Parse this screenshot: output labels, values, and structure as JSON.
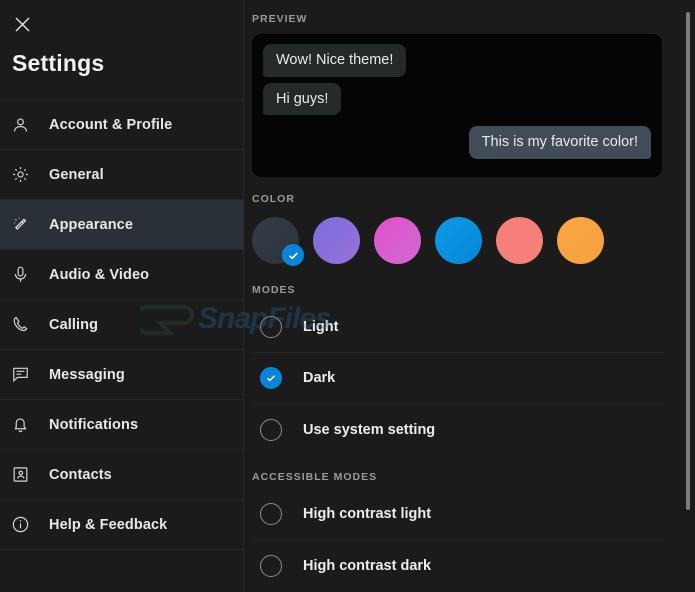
{
  "window": {
    "close_icon": "close-icon"
  },
  "sidebar": {
    "title": "Settings",
    "items": [
      {
        "label": "Account & Profile",
        "icon": "person-icon",
        "active": false
      },
      {
        "label": "General",
        "icon": "gear-icon",
        "active": false
      },
      {
        "label": "Appearance",
        "icon": "magic-wand-icon",
        "active": true
      },
      {
        "label": "Audio & Video",
        "icon": "microphone-icon",
        "active": false
      },
      {
        "label": "Calling",
        "icon": "phone-icon",
        "active": false
      },
      {
        "label": "Messaging",
        "icon": "chat-bubble-icon",
        "active": false
      },
      {
        "label": "Notifications",
        "icon": "bell-icon",
        "active": false
      },
      {
        "label": "Contacts",
        "icon": "contact-card-icon",
        "active": false
      },
      {
        "label": "Help & Feedback",
        "icon": "info-circle-icon",
        "active": false
      }
    ]
  },
  "main": {
    "preview": {
      "heading": "PREVIEW",
      "messages": [
        {
          "text": "Wow! Nice theme!",
          "direction": "in"
        },
        {
          "text": "Hi guys!",
          "direction": "in"
        },
        {
          "text": "This is my favorite color!",
          "direction": "out"
        }
      ]
    },
    "color": {
      "heading": "COLOR",
      "selected_index": 0,
      "swatches": [
        {
          "name": "slate",
          "from": "#343c46",
          "to": "#2b323b",
          "selected": true
        },
        {
          "name": "purple",
          "from": "#7b6fe0",
          "to": "#9a6fd8",
          "selected": false
        },
        {
          "name": "magenta",
          "from": "#e24fce",
          "to": "#d06ad2",
          "selected": false
        },
        {
          "name": "blue",
          "from": "#0d9ae8",
          "to": "#0587d4",
          "selected": false
        },
        {
          "name": "salmon",
          "from": "#fa7c7c",
          "to": "#ef8377",
          "selected": false
        },
        {
          "name": "orange",
          "from": "#fba745",
          "to": "#f5a03f",
          "selected": false
        }
      ]
    },
    "modes": {
      "heading": "MODES",
      "options": [
        {
          "label": "Light",
          "selected": false
        },
        {
          "label": "Dark",
          "selected": true
        },
        {
          "label": "Use system setting",
          "selected": false
        }
      ]
    },
    "accessible_modes": {
      "heading": "ACCESSIBLE MODES",
      "options": [
        {
          "label": "High contrast light",
          "selected": false
        },
        {
          "label": "High contrast dark",
          "selected": false
        }
      ]
    }
  },
  "watermark": {
    "text": "SnapFiles"
  },
  "colors": {
    "accent": "#0a84d8",
    "background": "#1b1b1b",
    "active_row": "#2a3038",
    "bubble_in": "#242a2a",
    "bubble_out": "#414c58"
  }
}
